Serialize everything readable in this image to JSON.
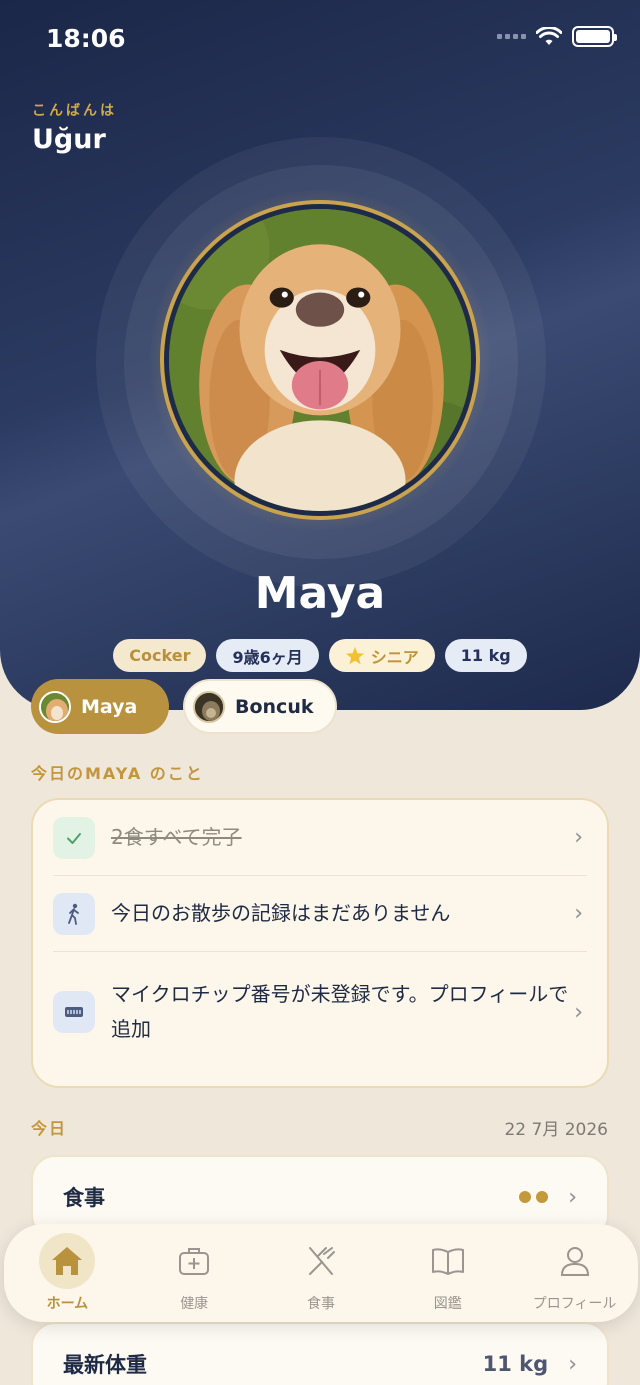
{
  "status_bar": {
    "time": "18:06"
  },
  "header": {
    "greeting": "こんばんは",
    "user_name": "Uğur",
    "pet_name": "Maya",
    "tags": {
      "breed": "Cocker",
      "age": "9歳6ヶ月",
      "senior": "シニア",
      "weight": "11 kg"
    }
  },
  "pets": [
    {
      "name": "Maya",
      "active": true
    },
    {
      "name": "Boncuk",
      "active": false
    }
  ],
  "tasks": {
    "section_label": "今日のMAYA のこと",
    "items": [
      {
        "text": "2食すべて完了",
        "icon": "check-icon",
        "done": true
      },
      {
        "text": "今日のお散歩の記録はまだありません",
        "icon": "walking-icon",
        "done": false
      },
      {
        "text": "マイクロチップ番号が未登録です。プロフィールで追加",
        "icon": "microchip-icon",
        "done": false
      }
    ]
  },
  "today": {
    "label": "今日",
    "date": "22 7月 2026",
    "meal_card_title": "食事",
    "meal_dots": 2,
    "weight_card_title": "最新体重",
    "weight_value": "11 kg"
  },
  "tabbar": {
    "items": [
      {
        "label": "ホーム",
        "icon": "home-icon",
        "active": true
      },
      {
        "label": "健康",
        "icon": "medical-kit-icon",
        "active": false
      },
      {
        "label": "食事",
        "icon": "fork-knife-icon",
        "active": false
      },
      {
        "label": "図鑑",
        "icon": "book-icon",
        "active": false
      },
      {
        "label": "プロフィール",
        "icon": "person-icon",
        "active": false
      }
    ]
  },
  "colors": {
    "accent_gold": "#b8923e",
    "header_navy": "#1f2a4a",
    "background": "#efe7da"
  }
}
